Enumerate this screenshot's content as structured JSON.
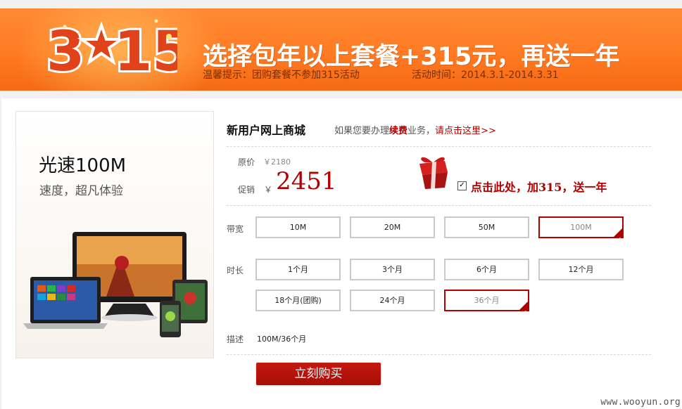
{
  "banner": {
    "logo_text": "3★15",
    "headline": "选择包年以上套餐+315元，再送一年",
    "tip": "温馨提示：团购套餐不参加315活动",
    "time": "活动时间：2014.3.1-2014.3.31"
  },
  "product": {
    "title": "光速100M",
    "subtitle": "速度，超凡体验"
  },
  "shop": {
    "title": "新用户网上商城",
    "hint_prefix": "如果您要办理",
    "hint_em": "续费",
    "hint_mid": "业务，",
    "hint_link": "请点击这里>>"
  },
  "price": {
    "orig_label": "原价",
    "orig_value": "￥2180",
    "promo_label": "促销",
    "currency": "￥",
    "promo_value": "2451"
  },
  "gift": {
    "checked": true,
    "text": "点击此处，加315，送一年"
  },
  "bandwidth": {
    "label": "带宽",
    "options": [
      "10M",
      "20M",
      "50M",
      "100M"
    ],
    "selected": "100M"
  },
  "duration": {
    "label": "时长",
    "options": [
      "1个月",
      "3个月",
      "6个月",
      "12个月",
      "18个月(团购)",
      "24个月",
      "36个月"
    ],
    "selected": "36个月"
  },
  "description": {
    "label": "描述",
    "value": "100M/36个月"
  },
  "buy_label": "立刻购买",
  "watermark": "www.wooyun.org",
  "colors": {
    "banner_orange": "#ff7a22",
    "accent_red": "#b00000",
    "button_red": "#b4140a"
  }
}
